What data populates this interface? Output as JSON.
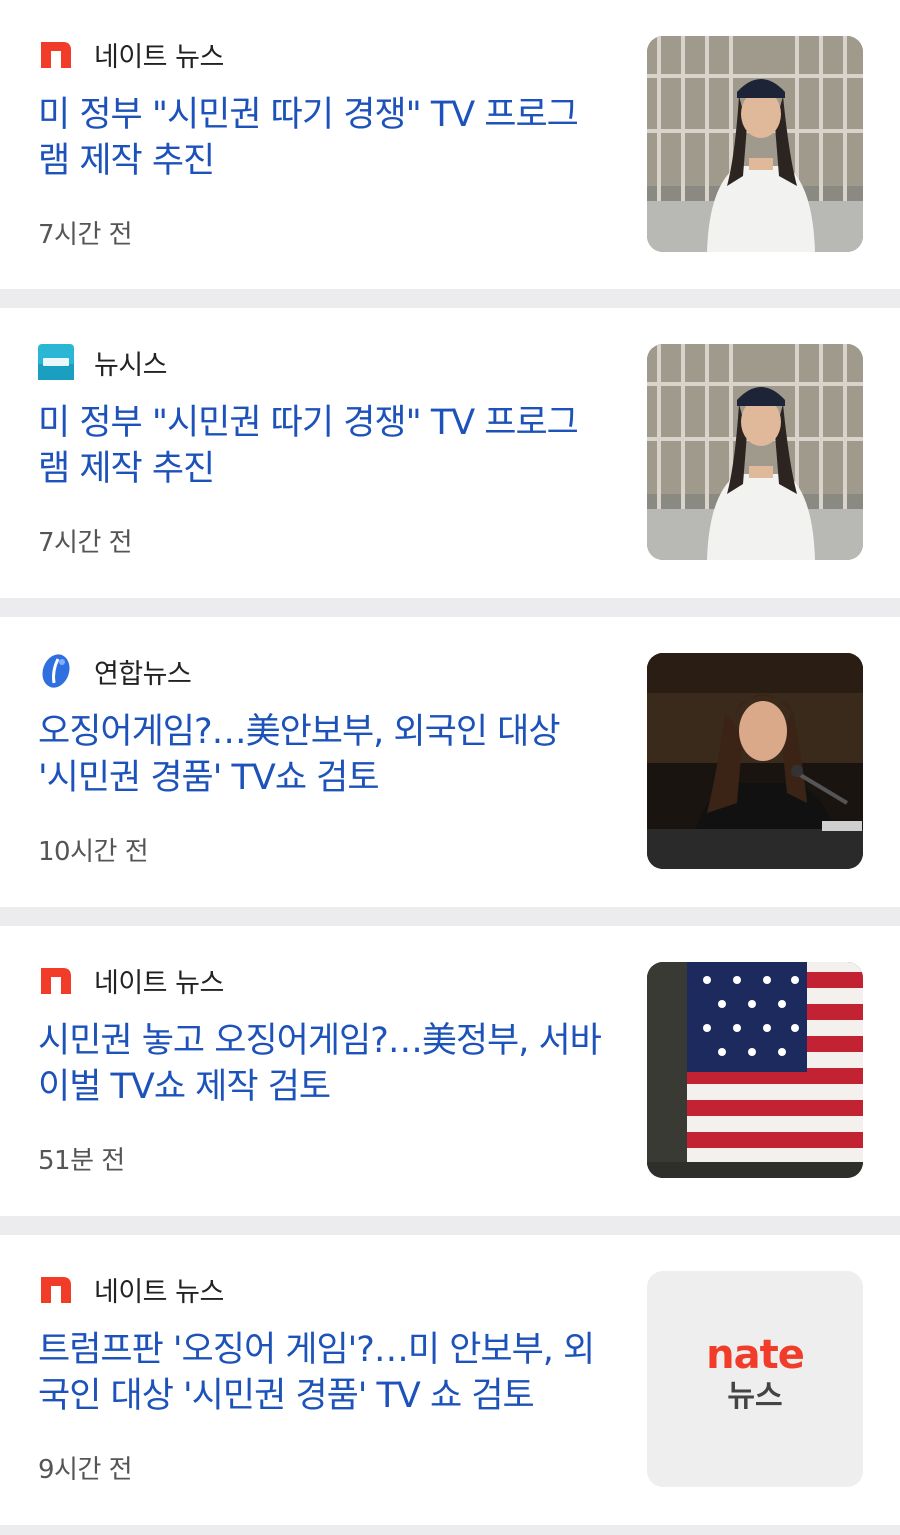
{
  "articles": [
    {
      "source": "네이트 뉴스",
      "source_icon": "nate-n-logo-icon",
      "headline": "미 정부 \"시민권 따기 경쟁\" TV 프로그램 제작 추진",
      "time": "7시간 전",
      "thumbnail": "woman-prison-bars-photo"
    },
    {
      "source": "뉴시스",
      "source_icon": "newsis-logo-icon",
      "headline": "미 정부 \"시민권 따기 경쟁\" TV 프로그램 제작 추진",
      "time": "7시간 전",
      "thumbnail": "woman-prison-bars-photo"
    },
    {
      "source": "연합뉴스",
      "source_icon": "yonhap-logo-icon",
      "headline": "오징어게임?…美안보부, 외국인 대상 '시민권 경품' TV쇼 검토",
      "time": "10시간 전",
      "thumbnail": "woman-hearing-microphone-photo"
    },
    {
      "source": "네이트 뉴스",
      "source_icon": "nate-n-logo-icon",
      "headline": "시민권 놓고 오징어게임?…美정부, 서바이벌 TV쇼 제작 검토",
      "time": "51분 전",
      "thumbnail": "us-flag-photo"
    },
    {
      "source": "네이트 뉴스",
      "source_icon": "nate-n-logo-icon",
      "headline": "트럼프판 '오징어 게임'?…미 안보부, 외국인 대상 '시민권 경품' TV 쇼 검토",
      "time": "9시간 전",
      "thumbnail": "nate-news-placeholder",
      "placeholder_brand": "nate",
      "placeholder_sub": "뉴스"
    }
  ],
  "colors": {
    "headline": "#1c52b9",
    "nate_red": "#f03c28",
    "newsis": "#2bb6d6",
    "yonhap": "#2f6fe0"
  }
}
